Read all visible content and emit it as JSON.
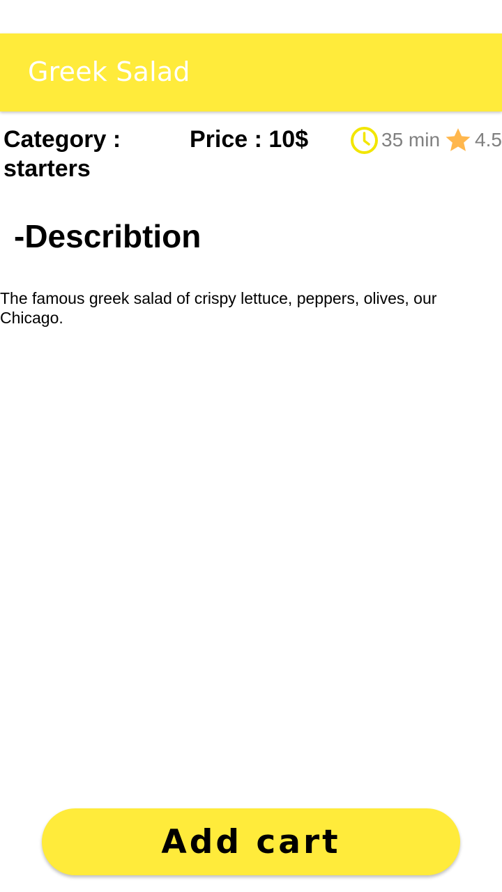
{
  "app_bar": {
    "title": "Greek Salad",
    "background_color": "#ffeb3b",
    "title_color": "#ffffff"
  },
  "details": {
    "category": "Category : starters",
    "price": "Price : 10$",
    "time": "35 min",
    "rating": "4.5",
    "time_icon": "clock-icon",
    "rating_icon": "star-icon",
    "clock_color": "#f2e600",
    "star_color": "#ffb74d",
    "meta_text_color": "#808080"
  },
  "description": {
    "heading": "-Describtion",
    "text": "The famous greek salad of crispy lettuce, peppers, olives, our Chicago."
  },
  "actions": {
    "add_cart_label": "Add cart",
    "button_color": "#ffeb3b"
  }
}
